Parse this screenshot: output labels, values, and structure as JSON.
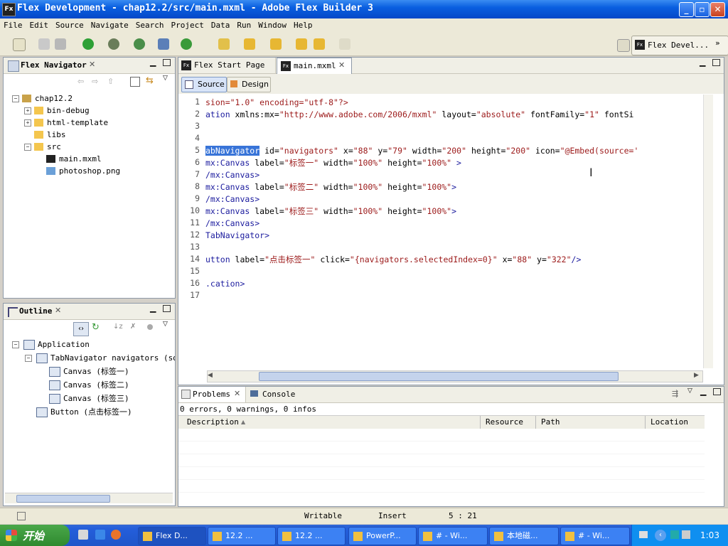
{
  "window": {
    "title": "Flex Development - chap12.2/src/main.mxml - Adobe Flex Builder 3",
    "icon": "Fx"
  },
  "menu": [
    "File",
    "Edit",
    "Source",
    "Navigate",
    "Search",
    "Project",
    "Data",
    "Run",
    "Window",
    "Help"
  ],
  "perspective": {
    "label": "Flex Devel..."
  },
  "navigator": {
    "title": "Flex Navigator",
    "tree": [
      {
        "label": "chap12.2",
        "depth": 0,
        "kind": "project",
        "expand": "−"
      },
      {
        "label": "bin-debug",
        "depth": 1,
        "kind": "folder",
        "expand": "+"
      },
      {
        "label": "html-template",
        "depth": 1,
        "kind": "folder",
        "expand": "+"
      },
      {
        "label": "libs",
        "depth": 1,
        "kind": "folder",
        "expand": ""
      },
      {
        "label": "src",
        "depth": 1,
        "kind": "folder",
        "expand": "−"
      },
      {
        "label": "main.mxml",
        "depth": 2,
        "kind": "mxml",
        "expand": ""
      },
      {
        "label": "photoshop.png",
        "depth": 2,
        "kind": "image",
        "expand": ""
      }
    ]
  },
  "outline": {
    "title": "Outline",
    "tree": [
      {
        "label": "Application",
        "depth": 0,
        "expand": "−"
      },
      {
        "label": "TabNavigator navigators (sou",
        "depth": 1,
        "expand": "−"
      },
      {
        "label": "Canvas (标签一)",
        "depth": 2,
        "expand": ""
      },
      {
        "label": "Canvas (标签二)",
        "depth": 2,
        "expand": ""
      },
      {
        "label": "Canvas (标签三)",
        "depth": 2,
        "expand": ""
      },
      {
        "label": "Button (点击标签一)",
        "depth": 1,
        "expand": ""
      }
    ]
  },
  "editor": {
    "tabs": [
      {
        "label": "Flex Start Page"
      },
      {
        "label": "main.mxml"
      }
    ],
    "modes": {
      "source": "Source",
      "design": "Design"
    },
    "line_numbers": [
      "1",
      "2",
      "3",
      "4",
      "5",
      "6",
      "7",
      "8",
      "9",
      "10",
      "11",
      "12",
      "13",
      "14",
      "15",
      "16",
      "17"
    ],
    "lines": [
      [
        [
          "str",
          "sion=\"1.0\" encoding=\"utf-8\"?>"
        ]
      ],
      [
        [
          "tag",
          "ation"
        ],
        [
          "attr",
          " xmlns:mx="
        ],
        [
          "str",
          "\"http://www.adobe.com/2006/mxml\""
        ],
        [
          "attr",
          " layout="
        ],
        [
          "str",
          "\"absolute\""
        ],
        [
          "attr",
          " fontFamily="
        ],
        [
          "str",
          "\"1\""
        ],
        [
          "attr",
          " fontSi"
        ]
      ],
      [],
      [],
      [
        [
          "sel",
          "abNavigator"
        ],
        [
          "attr",
          " id="
        ],
        [
          "str",
          "\"navigators\""
        ],
        [
          "attr",
          " x="
        ],
        [
          "str",
          "\"88\""
        ],
        [
          "attr",
          " y="
        ],
        [
          "str",
          "\"79\""
        ],
        [
          "attr",
          " width="
        ],
        [
          "str",
          "\"200\""
        ],
        [
          "attr",
          " height="
        ],
        [
          "str",
          "\"200\""
        ],
        [
          "attr",
          " icon="
        ],
        [
          "str",
          "\"@Embed(source='"
        ]
      ],
      [
        [
          "tag",
          "mx:Canvas"
        ],
        [
          "attr",
          " label="
        ],
        [
          "str",
          "\"标签一\""
        ],
        [
          "attr",
          " width="
        ],
        [
          "str",
          "\"100%\""
        ],
        [
          "attr",
          " height="
        ],
        [
          "str",
          "\"100%\""
        ],
        [
          "tag",
          " >"
        ]
      ],
      [
        [
          "tag",
          "/mx:Canvas>"
        ]
      ],
      [
        [
          "tag",
          "mx:Canvas"
        ],
        [
          "attr",
          " label="
        ],
        [
          "str",
          "\"标签二\""
        ],
        [
          "attr",
          " width="
        ],
        [
          "str",
          "\"100%\""
        ],
        [
          "attr",
          " height="
        ],
        [
          "str",
          "\"100%\""
        ],
        [
          "tag",
          ">"
        ]
      ],
      [
        [
          "tag",
          "/mx:Canvas>"
        ]
      ],
      [
        [
          "tag",
          "mx:Canvas"
        ],
        [
          "attr",
          " label="
        ],
        [
          "str",
          "\"标签三\""
        ],
        [
          "attr",
          " width="
        ],
        [
          "str",
          "\"100%\""
        ],
        [
          "attr",
          " height="
        ],
        [
          "str",
          "\"100%\""
        ],
        [
          "tag",
          ">"
        ]
      ],
      [
        [
          "tag",
          "/mx:Canvas>"
        ]
      ],
      [
        [
          "tag",
          "TabNavigator>"
        ]
      ],
      [],
      [
        [
          "tag",
          "utton"
        ],
        [
          "attr",
          " label="
        ],
        [
          "str",
          "\"点击标签一\""
        ],
        [
          "attr",
          " click="
        ],
        [
          "str",
          "\"{navigators.selectedIndex=0}\""
        ],
        [
          "attr",
          " x="
        ],
        [
          "str",
          "\"88\""
        ],
        [
          "attr",
          " y="
        ],
        [
          "str",
          "\"322\""
        ],
        [
          "tag",
          "/>"
        ]
      ],
      [],
      [
        [
          "tag",
          ".cation>"
        ]
      ],
      []
    ]
  },
  "problems": {
    "tabs": [
      {
        "label": "Problems"
      },
      {
        "label": "Console"
      }
    ],
    "summary": "0 errors, 0 warnings, 0 infos",
    "columns": [
      "Description",
      "Resource",
      "Path",
      "Location"
    ]
  },
  "status": {
    "writable": "Writable",
    "insert": "Insert",
    "position": "5 : 21"
  },
  "taskbar": {
    "start": "开始",
    "tasks": [
      "Flex D...",
      "12.2 ...",
      "12.2 ...",
      "PowerP...",
      "# - Wi...",
      "本地磁...",
      "# - Wi..."
    ],
    "clock": "1:03"
  },
  "colors": {
    "titlebar": "#0a5fe0",
    "selection": "#3874d8",
    "string": "#9c1a1a",
    "tag": "#1b1b9e"
  }
}
